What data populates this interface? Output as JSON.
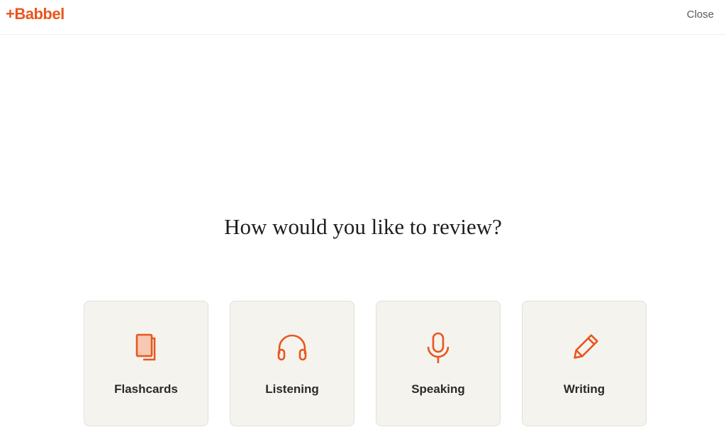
{
  "header": {
    "logo_text": "+Babbel",
    "close_label": "Close"
  },
  "main": {
    "heading": "How would you like to review?",
    "options": [
      {
        "label": "Flashcards",
        "icon": "flashcards-icon"
      },
      {
        "label": "Listening",
        "icon": "headphones-icon"
      },
      {
        "label": "Speaking",
        "icon": "microphone-icon"
      },
      {
        "label": "Writing",
        "icon": "pencil-icon"
      }
    ]
  },
  "colors": {
    "accent": "#e8561e",
    "card_background": "#f5f3ee",
    "card_border": "#e3e0da",
    "text": "#1e1e1e"
  }
}
